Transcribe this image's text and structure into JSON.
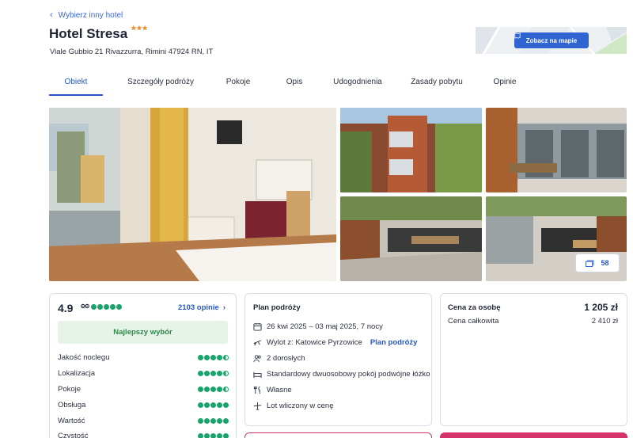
{
  "back_link": "Wybierz inny hotel",
  "hotel": {
    "name": "Hotel Stresa",
    "stars": "★★★",
    "address": "Viale Gubbio 21 Rivazzurra, Rimini 47924 RN, IT"
  },
  "map": {
    "button_label": "Zobacz na mapie"
  },
  "tabs": [
    {
      "label": "Obiekt",
      "active": true
    },
    {
      "label": "Szczegóły podróży"
    },
    {
      "label": "Pokoje"
    },
    {
      "label": "Opis"
    },
    {
      "label": "Udogodnienia"
    },
    {
      "label": "Zasady pobytu"
    },
    {
      "label": "Opinie"
    }
  ],
  "gallery": {
    "photo_count": "58"
  },
  "rating": {
    "score": "4.9",
    "reviews_link": "2103 opinie",
    "badge": "Najlepszy wybór",
    "categories": [
      {
        "label": "Jakość noclegu",
        "value": 4.5
      },
      {
        "label": "Lokalizacja",
        "value": 4.5
      },
      {
        "label": "Pokoje",
        "value": 4.5
      },
      {
        "label": "Obsługa",
        "value": 5
      },
      {
        "label": "Wartość",
        "value": 5
      },
      {
        "label": "Czystość",
        "value": 5
      }
    ]
  },
  "plan": {
    "title": "Plan podróży",
    "dates": "26 kwi 2025 – 03 maj 2025, 7 nocy",
    "departure": "Wylot z: Katowice Pyrzowice",
    "departure_link": "Plan podróży",
    "guests": "2 dorosłych",
    "room": "Standardowy dwuosobowy pokój podwójne łóżko",
    "board": "Własne",
    "flight": "Lot wliczony w cenę"
  },
  "price": {
    "per_person_label": "Cena za osobę",
    "per_person_value": "1 205 zł",
    "total_label": "Cena całkowita",
    "total_value": "2 410 zł"
  },
  "colors": {
    "accent": "#2457c8",
    "rating_green": "#1aa36b",
    "stars": "#ef8a2a",
    "cta_pink": "#d6336c"
  }
}
